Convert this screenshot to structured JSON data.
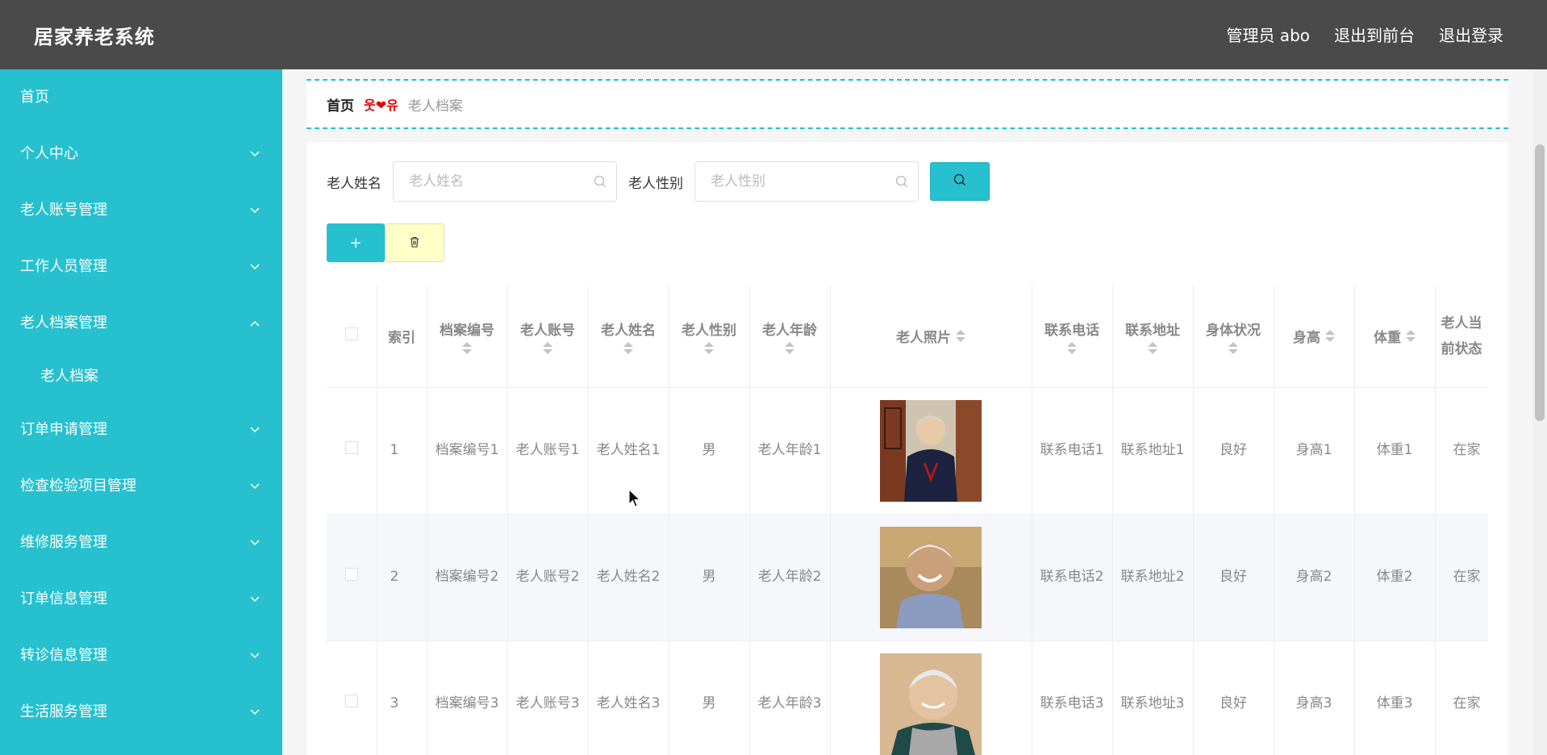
{
  "header": {
    "brand": "居家养老系统",
    "admin": "管理员 abo",
    "to_front": "退出到前台",
    "logout": "退出登录"
  },
  "sidebar": {
    "items": [
      {
        "label": "首页",
        "has_chevron": false
      },
      {
        "label": "个人中心",
        "has_chevron": true,
        "expanded": false
      },
      {
        "label": "老人账号管理",
        "has_chevron": true,
        "expanded": false
      },
      {
        "label": "工作人员管理",
        "has_chevron": true,
        "expanded": false
      },
      {
        "label": "老人档案管理",
        "has_chevron": true,
        "expanded": true
      },
      {
        "label": "订单申请管理",
        "has_chevron": true,
        "expanded": false
      },
      {
        "label": "检查检验项目管理",
        "has_chevron": true,
        "expanded": false
      },
      {
        "label": "维修服务管理",
        "has_chevron": true,
        "expanded": false
      },
      {
        "label": "订单信息管理",
        "has_chevron": true,
        "expanded": false
      },
      {
        "label": "转诊信息管理",
        "has_chevron": true,
        "expanded": false
      },
      {
        "label": "生活服务管理",
        "has_chevron": true,
        "expanded": false
      }
    ],
    "submenu": {
      "label": "老人档案"
    }
  },
  "breadcrumb": {
    "home": "首页",
    "separator": "웃❤유",
    "current": "老人档案"
  },
  "search": {
    "name_label": "老人姓名",
    "name_placeholder": "老人姓名",
    "gender_label": "老人性别",
    "gender_placeholder": "老人性别"
  },
  "actions": {
    "add_label": "+"
  },
  "table": {
    "columns": [
      {
        "label": "索引",
        "sortable": false
      },
      {
        "label": "档案编号",
        "sortable": true
      },
      {
        "label": "老人账号",
        "sortable": true
      },
      {
        "label": "老人姓名",
        "sortable": true
      },
      {
        "label": "老人性别",
        "sortable": true
      },
      {
        "label": "老人年龄",
        "sortable": true
      },
      {
        "label": "老人照片",
        "sortable": true
      },
      {
        "label": "联系电话",
        "sortable": true
      },
      {
        "label": "联系地址",
        "sortable": true
      },
      {
        "label": "身体状况",
        "sortable": true
      },
      {
        "label": "身高",
        "sortable": true
      },
      {
        "label": "体重",
        "sortable": true
      },
      {
        "label": "老人当前状态",
        "sortable": true
      }
    ],
    "rows": [
      {
        "index": "1",
        "file_no": "档案编号1",
        "account": "老人账号1",
        "name": "老人姓名1",
        "gender": "男",
        "age": "老人年龄1",
        "phone": "联系电话1",
        "address": "联系地址1",
        "health": "良好",
        "height": "身高1",
        "weight": "体重1",
        "status": "在家"
      },
      {
        "index": "2",
        "file_no": "档案编号2",
        "account": "老人账号2",
        "name": "老人姓名2",
        "gender": "男",
        "age": "老人年龄2",
        "phone": "联系电话2",
        "address": "联系地址2",
        "health": "良好",
        "height": "身高2",
        "weight": "体重2",
        "status": "在家"
      },
      {
        "index": "3",
        "file_no": "档案编号3",
        "account": "老人账号3",
        "name": "老人姓名3",
        "gender": "男",
        "age": "老人年龄3",
        "phone": "联系电话3",
        "address": "联系地址3",
        "health": "良好",
        "height": "身高3",
        "weight": "体重3",
        "status": "在家"
      }
    ]
  },
  "colors": {
    "accent": "#26c0cf",
    "topbar": "#4a4a4a",
    "delete_button": "#ffffc8"
  }
}
